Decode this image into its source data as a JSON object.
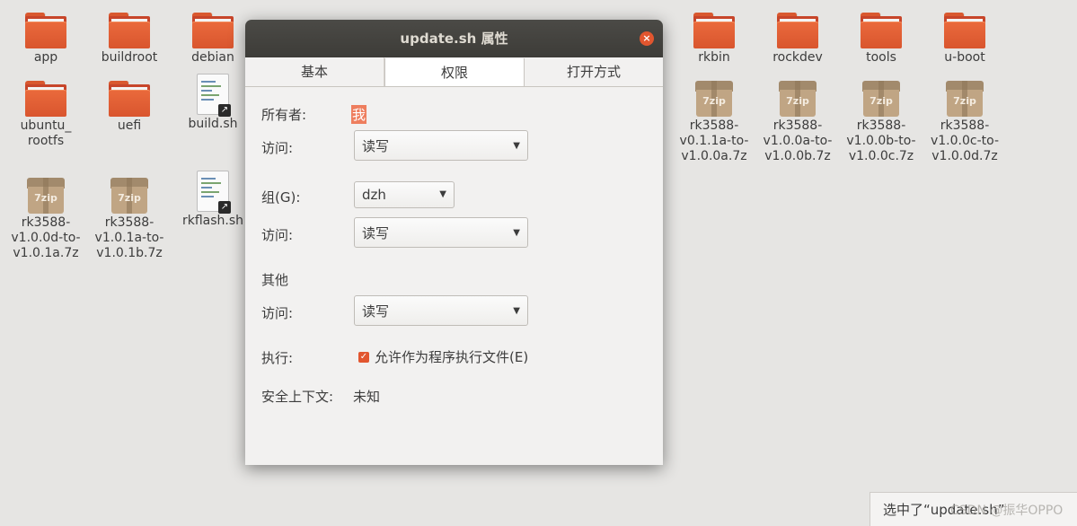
{
  "desktop": {
    "folders_row1": [
      {
        "label": "app"
      },
      {
        "label": "buildroot"
      },
      {
        "label": "debian"
      },
      {
        "label": "rkbin"
      },
      {
        "label": "rockdev"
      },
      {
        "label": "tools"
      },
      {
        "label": "u-boot"
      }
    ],
    "row2": [
      {
        "label": "ubuntu_\nrootfs",
        "kind": "folder"
      },
      {
        "label": "uefi",
        "kind": "folder"
      },
      {
        "label": "build.sh",
        "kind": "script"
      },
      {
        "label": "rk3588-\nv0.1.1a-to-\nv1.0.0a.7z",
        "kind": "archive"
      },
      {
        "label": "rk3588-\nv1.0.0a-to-\nv1.0.0b.7z",
        "kind": "archive"
      },
      {
        "label": "rk3588-\nv1.0.0b-to-\nv1.0.0c.7z",
        "kind": "archive"
      },
      {
        "label": "rk3588-\nv1.0.0c-to-\nv1.0.0d.7z",
        "kind": "archive"
      }
    ],
    "row3": [
      {
        "label": "rk3588-\nv1.0.0d-to-\nv1.0.1a.7z",
        "kind": "archive"
      },
      {
        "label": "rk3588-\nv1.0.1a-to-\nv1.0.1b.7z",
        "kind": "archive"
      },
      {
        "label": "rkflash.sh",
        "kind": "script"
      }
    ],
    "archive_tag": "7zip"
  },
  "dialog": {
    "title": "update.sh 属性",
    "close_glyph": "×",
    "tabs": [
      {
        "label": "基本"
      },
      {
        "label": "权限"
      },
      {
        "label": "打开方式"
      }
    ],
    "owner_label": "所有者:",
    "owner_value": "我",
    "owner_access_label": "访问:",
    "owner_access_value": "读写",
    "group_label": "组(G):",
    "group_value": "dzh",
    "group_access_label": "访问:",
    "group_access_value": "读写",
    "others_label": "其他",
    "others_access_label": "访问:",
    "others_access_value": "读写",
    "execute_label": "执行:",
    "execute_checkbox_label": "允许作为程序执行文件(E)",
    "execute_checked": true,
    "security_label": "安全上下文:",
    "security_value": "未知"
  },
  "statusbar": {
    "text": "选中了“update.sh”",
    "watermark": "CSDN @振华OPPO"
  },
  "colors": {
    "accent": "#e2562f",
    "folder": "#e0603a",
    "titlebar": "#3d3c38"
  }
}
